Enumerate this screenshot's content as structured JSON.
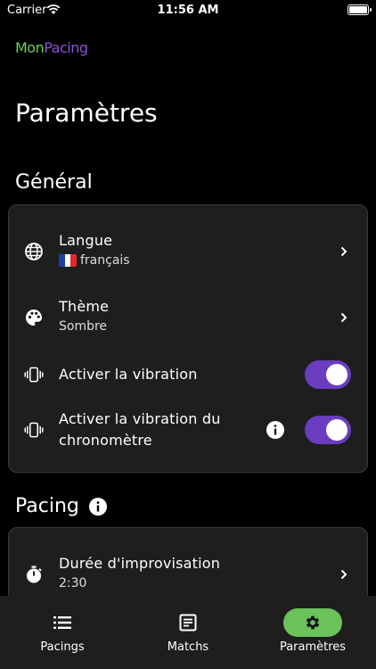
{
  "status_bar": {
    "carrier": "Carrier",
    "time": "11:56 AM"
  },
  "app": {
    "logo_mon": "Mon",
    "logo_pacing": "Pacing"
  },
  "page": {
    "title": "Paramètres"
  },
  "general": {
    "section_title": "Général",
    "langue": {
      "title": "Langue",
      "value": "français"
    },
    "theme": {
      "title": "Thème",
      "value": "Sombre"
    },
    "vibration": {
      "title": "Activer la vibration",
      "enabled": true
    },
    "chrono_vibration": {
      "title_line1": "Activer la vibration du",
      "title_line2": "chronomètre",
      "enabled": true
    }
  },
  "pacing": {
    "section_title": "Pacing",
    "improv_duration": {
      "title": "Durée d'improvisation",
      "value": "2:30"
    }
  },
  "bottom_nav": {
    "items": [
      {
        "label": "Pacings",
        "icon": "list-icon",
        "active": false
      },
      {
        "label": "Matchs",
        "icon": "document-icon",
        "active": false
      },
      {
        "label": "Paramètres",
        "icon": "gear-icon",
        "active": true
      }
    ]
  },
  "colors": {
    "accent_purple": "#6a3cbf",
    "accent_green": "#6bc25a",
    "card_bg": "#1e1e1e"
  }
}
